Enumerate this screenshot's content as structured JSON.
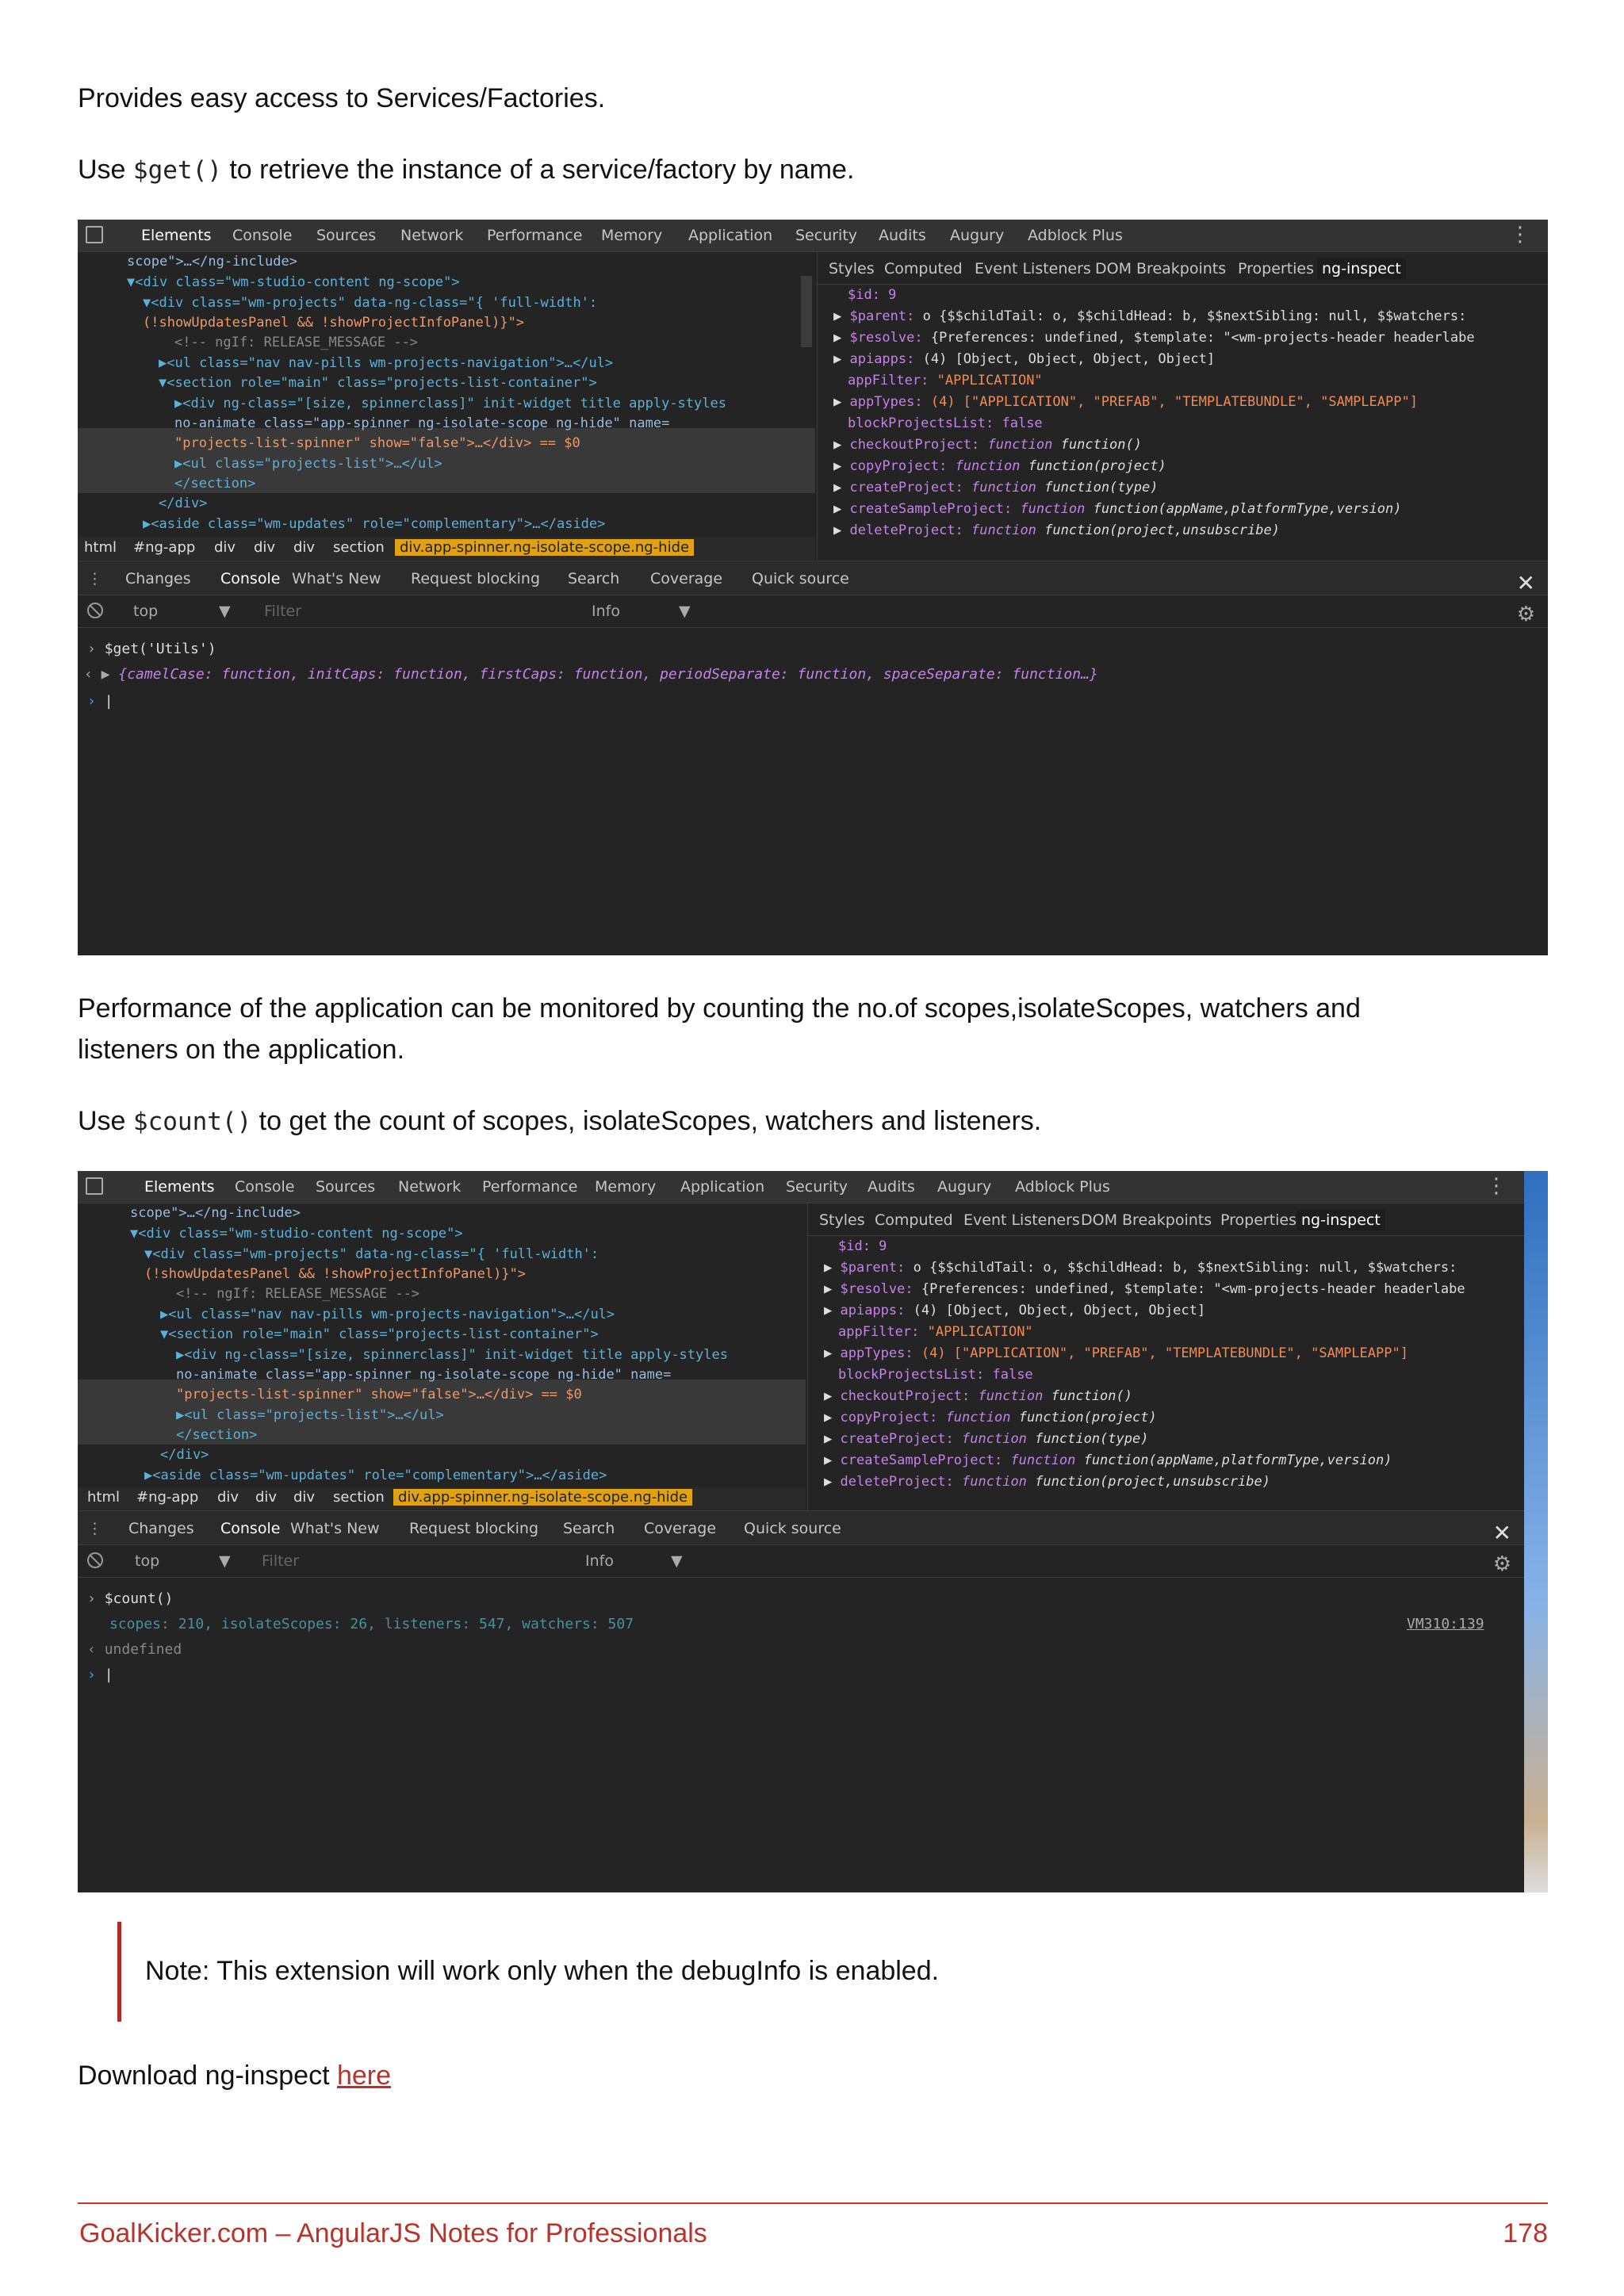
{
  "intro": {
    "line1": "Provides easy access to Services/Factories.",
    "line2_pre": "Use ",
    "line2_code": "$get()",
    "line2_post": " to retrieve the instance of a service/factory by name."
  },
  "perf": {
    "line1": "Performance of the application can be monitored by counting the no.of scopes,isolateScopes, watchers and",
    "line2": "listeners on the application.",
    "line3_pre": "Use ",
    "line3_code": "$count()",
    "line3_post": " to get the count of scopes, isolateScopes, watchers and listeners."
  },
  "devtools": {
    "main_tabs": [
      "Elements",
      "Console",
      "Sources",
      "Network",
      "Performance",
      "Memory",
      "Application",
      "Security",
      "Audits",
      "Augury",
      "Adblock Plus"
    ],
    "side_tabs": [
      "Styles",
      "Computed",
      "Event Listeners",
      "DOM Breakpoints",
      "Properties",
      "ng-inspect"
    ],
    "drawer_tabs": [
      "Changes",
      "Console",
      "What's New",
      "Request blocking",
      "Search",
      "Coverage",
      "Quick source"
    ],
    "context": "top",
    "filter_placeholder": "Filter",
    "level": "Info",
    "breadcrumbs": [
      "html",
      "#ng-app",
      "div",
      "div",
      "div",
      "section"
    ],
    "breadcrumb_active": "div.app-spinner.ng-isolate-scope.ng-hide",
    "elements_lines": [
      "scope\">…</ng-include>",
      "▼<div class=\"wm-studio-content ng-scope\">",
      "▼<div class=\"wm-projects\" data-ng-class=\"{ 'full-width':",
      "(!showUpdatesPanel && !showProjectInfoPanel)}\">",
      "<!-- ngIf: RELEASE_MESSAGE -->",
      "▶<ul class=\"nav nav-pills wm-projects-navigation\">…</ul>",
      "▼<section role=\"main\" class=\"projects-list-container\">",
      "▶<div ng-class=\"[size, spinnerclass]\" init-widget title apply-styles",
      "no-animate class=\"app-spinner ng-isolate-scope ng-hide\" name=",
      "\"projects-list-spinner\" show=\"false\">…</div> == $0",
      "▶<ul class=\"projects-list\">…</ul>",
      "</section>",
      "</div>",
      "▶<aside class=\"wm-updates\" role=\"complementary\">…</aside>"
    ],
    "props": {
      "id": "$id: 9",
      "parent_k": "$parent:",
      "parent_v": "o {$$childTail: o, $$childHead: b, $$nextSibling: null, $$watchers:",
      "resolve_k": "$resolve:",
      "resolve_v": "{Preferences: undefined, $template: \"<wm-projects-header headerlabe",
      "apiapps_k": "apiapps:",
      "apiapps_v": "(4) [Object, Object, Object, Object]",
      "appfilter_k": "appFilter:",
      "appfilter_v": "\"APPLICATION\"",
      "apptypes_k": "appTypes:",
      "apptypes_v": "(4) [\"APPLICATION\", \"PREFAB\", \"TEMPLATEBUNDLE\", \"SAMPLEAPP\"]",
      "blocked_k": "blockProjectsList:",
      "blocked_v": "false",
      "checkout_k": "checkoutProject:",
      "checkout_v": "function()",
      "copy_k": "copyProject:",
      "copy_v": "function(project)",
      "create_k": "createProject:",
      "create_v": "function(type)",
      "sample_k": "createSampleProject:",
      "sample_v": "function(appName,platformType,version)",
      "delete_k": "deleteProject:",
      "delete_v": "function(project,unsubscribe)",
      "fn_word": "function"
    }
  },
  "console1": {
    "input": "$get('Utils')",
    "output": "{camelCase: function, initCaps: function, firstCaps: function, periodSeparate: function, spaceSeparate: function…}"
  },
  "console2": {
    "input": "$count()",
    "output": "scopes: 210, isolateScopes: 26, listeners: 547, watchers: 507",
    "source_link": "VM310:139",
    "result": "undefined"
  },
  "note": "Note: This extension will work only when the debugInfo is enabled.",
  "download": {
    "text": "Download ng-inspect ",
    "link": "here"
  },
  "footer": {
    "left": "GoalKicker.com – AngularJS Notes for Professionals",
    "page": "178"
  },
  "colors": {
    "accent": "#b7332b",
    "devtools_bg": "#242424",
    "breadcrumb_highlight": "#e0a213"
  }
}
